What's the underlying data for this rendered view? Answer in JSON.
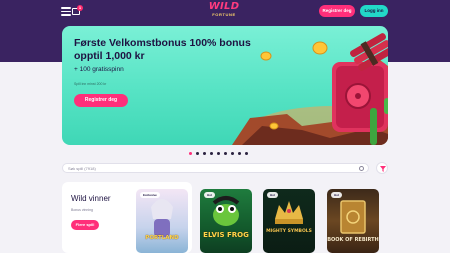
{
  "header": {
    "notification_count": "1",
    "logo_line1": "WILD",
    "logo_line2": "FORTUNE",
    "register_label": "Registrer deg",
    "login_label": "Logg inn"
  },
  "hero": {
    "title": "Første Velkomstbonus 100% bonus opptil 1,000 kr",
    "subtitle": "+ 100 gratisspinn",
    "min_deposit": "Spill inn minst 200 kr",
    "cta_label": "Registrer deg"
  },
  "carousel": {
    "dot_count": 9,
    "active_index": 0
  },
  "search": {
    "placeholder": "Søk spill (7918)"
  },
  "winners": {
    "title": "Wild vinner",
    "subtitle": "Bonus vinning",
    "button_label": "Flere spill"
  },
  "games": [
    {
      "tag": "Exclusive",
      "name": "PORTLAND"
    },
    {
      "tag": "Hot",
      "name": "ELVIS FROG"
    },
    {
      "tag": "Hot",
      "name": "MIGHTY SYMBOLS"
    },
    {
      "tag": "Hot",
      "name": "BOOK OF REBIRTH"
    }
  ],
  "colors": {
    "header_bg": "#3a2361",
    "accent_pink": "#ff2f7a",
    "accent_teal": "#22d8c8",
    "hero_bg": "#56e3c4"
  }
}
